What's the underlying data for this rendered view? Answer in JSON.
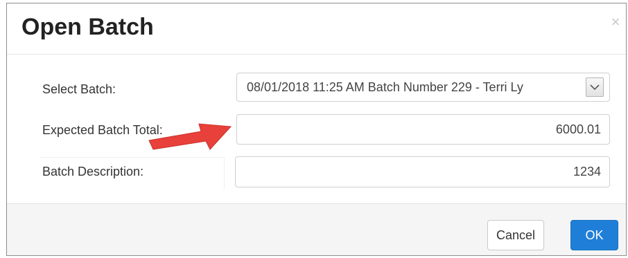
{
  "dialog": {
    "title": "Open Batch",
    "close_icon": "close-icon"
  },
  "form": {
    "select_batch_label": "Select Batch:",
    "select_batch_value": "08/01/2018 11:25 AM Batch Number 229 - Terri Ly",
    "expected_total_label": "Expected Batch Total:",
    "expected_total_value": "6000.01",
    "description_label": "Batch Description:",
    "description_value": "1234"
  },
  "footer": {
    "cancel_label": "Cancel",
    "ok_label": "OK"
  },
  "colors": {
    "primary": "#1f7fd8",
    "annotation_arrow": "#e8403a"
  }
}
